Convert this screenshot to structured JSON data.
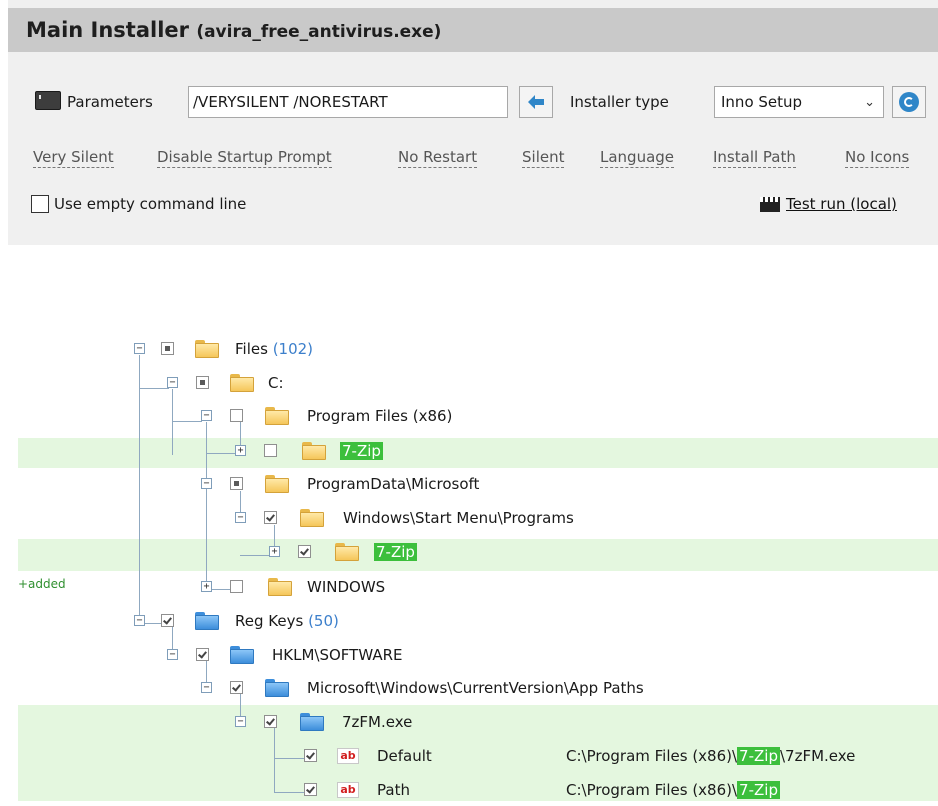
{
  "header": {
    "title": "Main Installer",
    "subtitle": "(avira_free_antivirus.exe)"
  },
  "params": {
    "label": "Parameters",
    "value": "/VERYSILENT /NORESTART",
    "installer_type_label": "Installer type",
    "installer_type_value": "Inno Setup"
  },
  "presets": [
    "Very Silent",
    "Disable Startup Prompt",
    "No Restart",
    "Silent",
    "Language",
    "Install Path",
    "No Icons"
  ],
  "empty_cmd_label": "Use empty command line",
  "test_run_label": "Test run (local)",
  "added_label": "+added",
  "tree": {
    "files": {
      "label": "Files",
      "count": "(102)"
    },
    "c_drive": "C:",
    "program_files": "Program Files (x86)",
    "zip1": "7-Zip",
    "programdata": "ProgramData\\Microsoft",
    "start_menu": "Windows\\Start Menu\\Programs",
    "zip2": "7-Zip",
    "windows": "WINDOWS",
    "reg_keys": {
      "label": "Reg Keys",
      "count": "(50)"
    },
    "hklm": "HKLM\\SOFTWARE",
    "app_paths": "Microsoft\\Windows\\CurrentVersion\\App Paths",
    "zfm": "7zFM.exe",
    "default": {
      "name": "Default",
      "value_prefix": "C:\\Program Files (x86)\\",
      "value_hl": "7-Zip",
      "value_suffix": "\\7zFM.exe"
    },
    "path": {
      "name": "Path",
      "value_prefix": "C:\\Program Files (x86)\\",
      "value_hl": "7-Zip"
    },
    "value_icon_text": "ab"
  },
  "colors": {
    "added_band": "#e4f7df",
    "highlight": "#3cbf3c",
    "count_blue": "#3c7fcb",
    "header_bg": "#c9c9c9",
    "panel_bg": "#f0f0f0"
  }
}
